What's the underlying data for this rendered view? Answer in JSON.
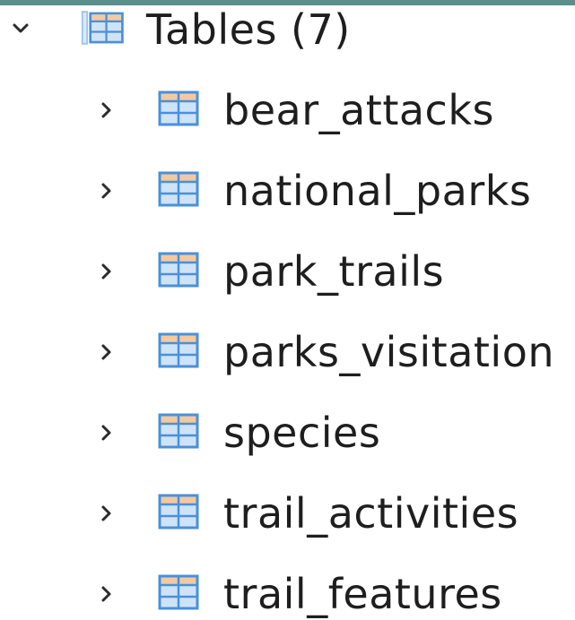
{
  "tree": {
    "group": {
      "label": "Tables (7)",
      "expanded": true,
      "icon": "table-icon",
      "expand_icon": "chevron-down-icon"
    },
    "items": [
      {
        "label": "bear_attacks",
        "icon": "table-icon",
        "expand_icon": "chevron-right-icon"
      },
      {
        "label": "national_parks",
        "icon": "table-icon",
        "expand_icon": "chevron-right-icon"
      },
      {
        "label": "park_trails",
        "icon": "table-icon",
        "expand_icon": "chevron-right-icon"
      },
      {
        "label": "parks_visitation",
        "icon": "table-icon",
        "expand_icon": "chevron-right-icon"
      },
      {
        "label": "species",
        "icon": "table-icon",
        "expand_icon": "chevron-right-icon"
      },
      {
        "label": "trail_activities",
        "icon": "table-icon",
        "expand_icon": "chevron-right-icon"
      },
      {
        "label": "trail_features",
        "icon": "table-icon",
        "expand_icon": "chevron-right-icon"
      }
    ]
  },
  "colors": {
    "text": "#1e1e1e",
    "icon_stroke": "#4a90d9",
    "icon_fill": "#cfe3f7",
    "icon_header": "#f3c9a0",
    "chevron": "#2b2b2b",
    "top_band": "#5a8f8c"
  }
}
